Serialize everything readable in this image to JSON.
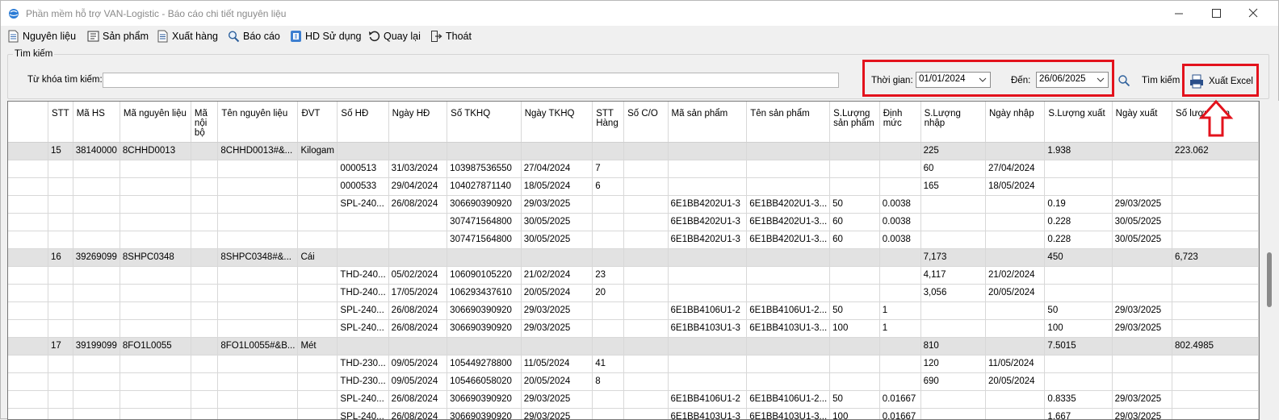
{
  "window": {
    "title": "Phần mềm hỗ trợ VAN-Logistic - Báo cáo chi tiết nguyên liệu"
  },
  "menu": [
    {
      "label": "Nguyên liệu",
      "icon": "document-icon"
    },
    {
      "label": "Sản phẩm",
      "icon": "product-icon"
    },
    {
      "label": "Xuất hàng",
      "icon": "export-icon"
    },
    {
      "label": "Báo cáo",
      "icon": "magnifier-icon"
    },
    {
      "label": "HD Sử dụng",
      "icon": "help-icon"
    },
    {
      "label": "Quay lại",
      "icon": "undo-icon"
    },
    {
      "label": "Thoát",
      "icon": "exit-icon"
    }
  ],
  "search": {
    "group_label": "Tìm kiếm",
    "keyword_label": "Từ khóa tìm kiếm:",
    "keyword_value": "",
    "time_label": "Thời gian:",
    "from_date": "01/01/2024",
    "to_label": "Đến:",
    "to_date": "26/06/2025",
    "search_button": "Tìm kiếm",
    "export_button": "Xuất Excel"
  },
  "colors": {
    "highlight": "#e3121c",
    "group_row": "#e2e2e2"
  },
  "table": {
    "headers": [
      "",
      "STT",
      "Mã HS",
      "Mã nguyên liệu",
      "Mã nội bộ",
      "Tên nguyên liệu",
      "ĐVT",
      "Số HĐ",
      "Ngày HĐ",
      "Số TKHQ",
      "Ngày TKHQ",
      "STT Hàng",
      "Số C/O",
      "Mã sản phẩm",
      "Tên sản phẩm",
      "S.Lượng sản phẩm",
      "Định mức",
      "S.Lượng nhập",
      "Ngày nhập",
      "S.Lượng xuất",
      "Ngày xuất",
      "Số lượng tồn"
    ],
    "rows": [
      {
        "group": true,
        "cells": [
          "",
          "15",
          "38140000",
          "8CHHD0013",
          "",
          "8CHHD0013#&...",
          "Kilogam",
          "",
          "",
          "",
          "",
          "",
          "",
          "",
          "",
          "",
          "",
          "225",
          "",
          "1.938",
          "",
          "223.062"
        ]
      },
      {
        "group": false,
        "cells": [
          "",
          "",
          "",
          "",
          "",
          "",
          "",
          "0000513",
          "31/03/2024",
          "103987536550",
          "27/04/2024",
          "7",
          "",
          "",
          "",
          "",
          "",
          "60",
          "27/04/2024",
          "",
          "",
          ""
        ]
      },
      {
        "group": false,
        "cells": [
          "",
          "",
          "",
          "",
          "",
          "",
          "",
          "0000533",
          "29/04/2024",
          "104027871140",
          "18/05/2024",
          "6",
          "",
          "",
          "",
          "",
          "",
          "165",
          "18/05/2024",
          "",
          "",
          ""
        ]
      },
      {
        "group": false,
        "cells": [
          "",
          "",
          "",
          "",
          "",
          "",
          "",
          "SPL-240...",
          "26/08/2024",
          "306690390920",
          "29/03/2025",
          "",
          "",
          "6E1BB4202U1-3",
          "6E1BB4202U1-3...",
          "50",
          "0.0038",
          "",
          "",
          "0.19",
          "29/03/2025",
          ""
        ]
      },
      {
        "group": false,
        "cells": [
          "",
          "",
          "",
          "",
          "",
          "",
          "",
          "",
          "",
          "307471564800",
          "30/05/2025",
          "",
          "",
          "6E1BB4202U1-3",
          "6E1BB4202U1-3...",
          "60",
          "0.0038",
          "",
          "",
          "0.228",
          "30/05/2025",
          ""
        ]
      },
      {
        "group": false,
        "cells": [
          "",
          "",
          "",
          "",
          "",
          "",
          "",
          "",
          "",
          "307471564800",
          "30/05/2025",
          "",
          "",
          "6E1BB4202U1-3",
          "6E1BB4202U1-3...",
          "60",
          "0.0038",
          "",
          "",
          "0.228",
          "30/05/2025",
          ""
        ]
      },
      {
        "group": true,
        "cells": [
          "",
          "16",
          "39269099",
          "8SHPC0348",
          "",
          "8SHPC0348#&...",
          "Cái",
          "",
          "",
          "",
          "",
          "",
          "",
          "",
          "",
          "",
          "",
          "7,173",
          "",
          "450",
          "",
          "6,723"
        ]
      },
      {
        "group": false,
        "cells": [
          "",
          "",
          "",
          "",
          "",
          "",
          "",
          "THD-240...",
          "05/02/2024",
          "106090105220",
          "21/02/2024",
          "23",
          "",
          "",
          "",
          "",
          "",
          "4,117",
          "21/02/2024",
          "",
          "",
          ""
        ]
      },
      {
        "group": false,
        "cells": [
          "",
          "",
          "",
          "",
          "",
          "",
          "",
          "THD-240...",
          "17/05/2024",
          "106293437610",
          "20/05/2024",
          "20",
          "",
          "",
          "",
          "",
          "",
          "3,056",
          "20/05/2024",
          "",
          "",
          ""
        ]
      },
      {
        "group": false,
        "cells": [
          "",
          "",
          "",
          "",
          "",
          "",
          "",
          "SPL-240...",
          "26/08/2024",
          "306690390920",
          "29/03/2025",
          "",
          "",
          "6E1BB4106U1-2",
          "6E1BB4106U1-2...",
          "50",
          "1",
          "",
          "",
          "50",
          "29/03/2025",
          ""
        ]
      },
      {
        "group": false,
        "cells": [
          "",
          "",
          "",
          "",
          "",
          "",
          "",
          "SPL-240...",
          "26/08/2024",
          "306690390920",
          "29/03/2025",
          "",
          "",
          "6E1BB4103U1-3",
          "6E1BB4103U1-3...",
          "100",
          "1",
          "",
          "",
          "100",
          "29/03/2025",
          ""
        ]
      },
      {
        "group": true,
        "cells": [
          "",
          "17",
          "39199099",
          "8FO1L0055",
          "",
          "8FO1L0055#&B...",
          "Mét",
          "",
          "",
          "",
          "",
          "",
          "",
          "",
          "",
          "",
          "",
          "810",
          "",
          "7.5015",
          "",
          "802.4985"
        ]
      },
      {
        "group": false,
        "cells": [
          "",
          "",
          "",
          "",
          "",
          "",
          "",
          "THD-230...",
          "09/05/2024",
          "105449278800",
          "11/05/2024",
          "41",
          "",
          "",
          "",
          "",
          "",
          "120",
          "11/05/2024",
          "",
          "",
          ""
        ]
      },
      {
        "group": false,
        "cells": [
          "",
          "",
          "",
          "",
          "",
          "",
          "",
          "THD-230...",
          "09/05/2024",
          "105466058020",
          "20/05/2024",
          "8",
          "",
          "",
          "",
          "",
          "",
          "690",
          "20/05/2024",
          "",
          "",
          ""
        ]
      },
      {
        "group": false,
        "cells": [
          "",
          "",
          "",
          "",
          "",
          "",
          "",
          "SPL-240...",
          "26/08/2024",
          "306690390920",
          "29/03/2025",
          "",
          "",
          "6E1BB4106U1-2",
          "6E1BB4106U1-2...",
          "50",
          "0.01667",
          "",
          "",
          "0.8335",
          "29/03/2025",
          ""
        ]
      },
      {
        "group": false,
        "cells": [
          "",
          "",
          "",
          "",
          "",
          "",
          "",
          "SPL-240...",
          "26/08/2024",
          "306690390920",
          "29/03/2025",
          "",
          "",
          "6E1BB4103U1-3",
          "6E1BB4103U1-3...",
          "100",
          "0.01667",
          "",
          "",
          "1.667",
          "29/03/2025",
          ""
        ]
      }
    ]
  }
}
